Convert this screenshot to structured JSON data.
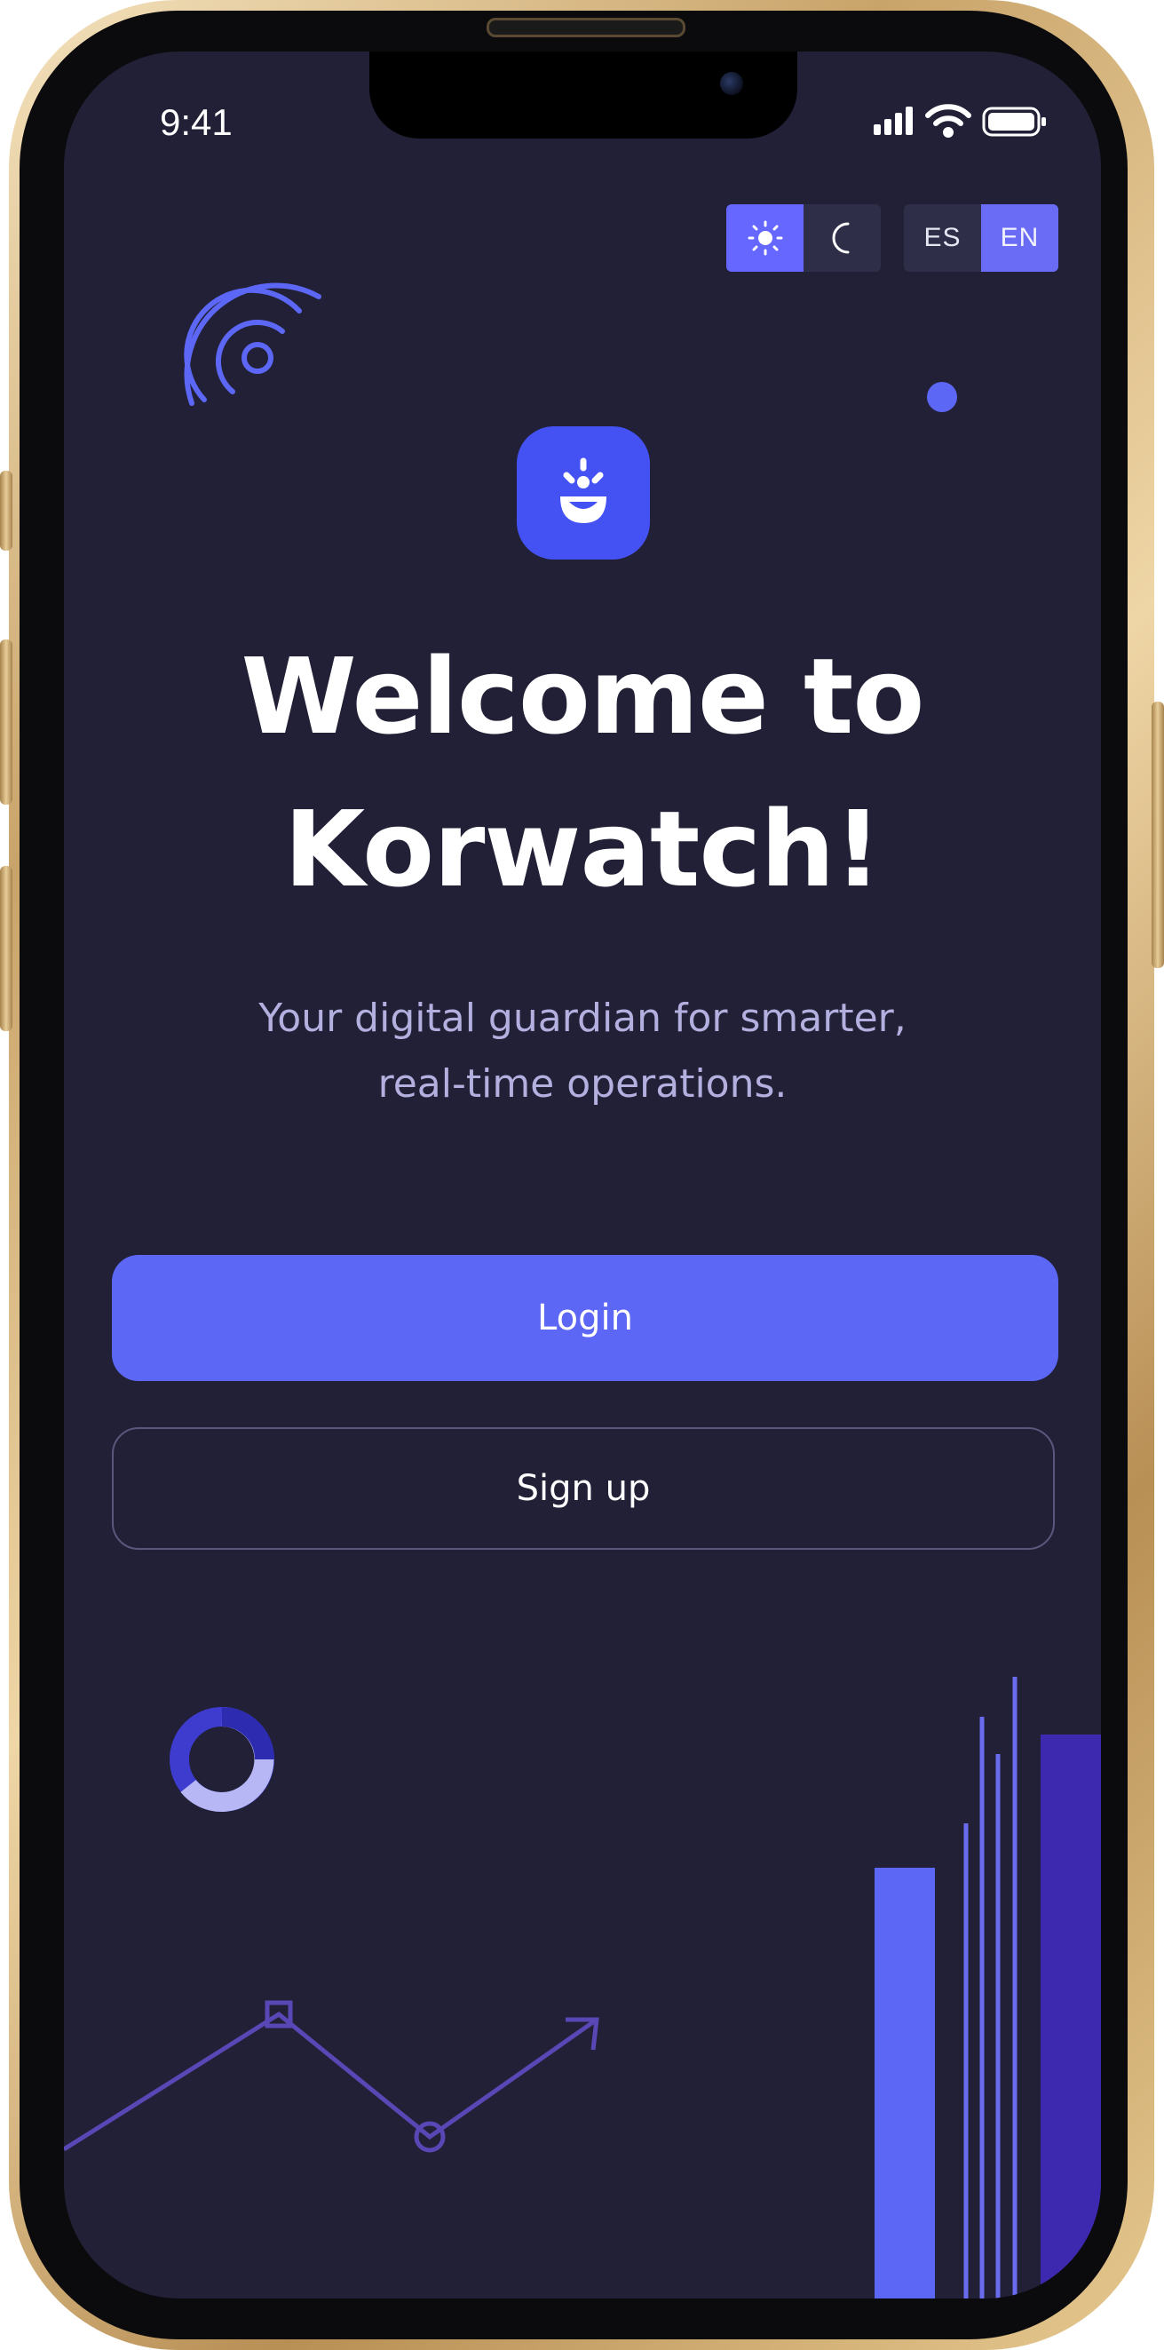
{
  "status_bar": {
    "time": "9:41",
    "icons": [
      "cellular-signal-icon",
      "wifi-icon",
      "battery-icon"
    ]
  },
  "theme_toggle": {
    "options": [
      {
        "icon": "sun-icon",
        "selected": true
      },
      {
        "icon": "moon-icon",
        "selected": false
      }
    ]
  },
  "language_toggle": {
    "options": [
      {
        "label": "ES",
        "selected": false
      },
      {
        "label": "EN",
        "selected": true
      }
    ]
  },
  "logo": {
    "icon": "smile-logo-icon"
  },
  "welcome": {
    "title_line1": "Welcome to",
    "title_line2": "Korwatch!",
    "subtitle_line1": "Your digital guardian for smarter,",
    "subtitle_line2": "real-time operations."
  },
  "actions": {
    "login_label": "Login",
    "signup_label": "Sign up"
  },
  "colors": {
    "background": "#212036",
    "accent": "#5d67f6",
    "logo": "#4552f3",
    "subtitle": "#b3b0df",
    "decoration_dark": "#3d29b0",
    "decoration_line": "#5947b5"
  }
}
